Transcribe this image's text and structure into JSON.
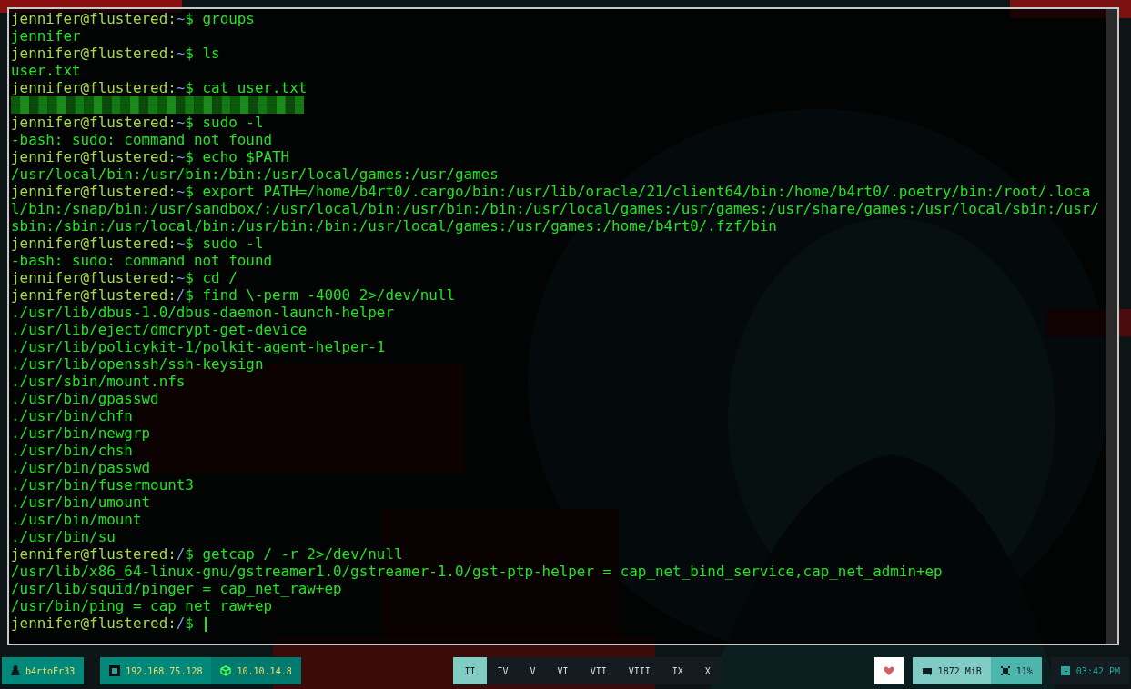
{
  "terminal": {
    "lines": [
      {
        "kind": "prompt",
        "user": "jennifer@flustered:",
        "path": "~",
        "sign": "$",
        "command": "groups"
      },
      {
        "kind": "output",
        "text": "jennifer"
      },
      {
        "kind": "prompt",
        "user": "jennifer@flustered:",
        "path": "~",
        "sign": "$",
        "command": "ls"
      },
      {
        "kind": "output",
        "text": "user.txt"
      },
      {
        "kind": "prompt",
        "user": "jennifer@flustered:",
        "path": "~",
        "sign": "$",
        "command": "cat user.txt"
      },
      {
        "kind": "redacted"
      },
      {
        "kind": "prompt",
        "user": "jennifer@flustered:",
        "path": "~",
        "sign": "$",
        "command": "sudo -l"
      },
      {
        "kind": "output",
        "text": "-bash: sudo: command not found"
      },
      {
        "kind": "prompt",
        "user": "jennifer@flustered:",
        "path": "~",
        "sign": "$",
        "command": "echo $PATH"
      },
      {
        "kind": "output",
        "text": "/usr/local/bin:/usr/bin:/bin:/usr/local/games:/usr/games"
      },
      {
        "kind": "prompt",
        "user": "jennifer@flustered:",
        "path": "~",
        "sign": "$",
        "command": "export PATH=/home/b4rt0/.cargo/bin:/usr/lib/oracle/21/client64/bin:/home/b4rt0/.poetry/bin:/root/.local/bin:/snap/bin:/usr/sandbox/:/usr/local/bin:/usr/bin:/bin:/usr/local/games:/usr/games:/usr/share/games:/usr/local/sbin:/usr/sbin:/sbin:/usr/local/bin:/usr/bin:/bin:/usr/local/games:/usr/games:/home/b4rt0/.fzf/bin"
      },
      {
        "kind": "prompt",
        "user": "jennifer@flustered:",
        "path": "~",
        "sign": "$",
        "command": "sudo -l"
      },
      {
        "kind": "output",
        "text": "-bash: sudo: command not found"
      },
      {
        "kind": "prompt",
        "user": "jennifer@flustered:",
        "path": "~",
        "sign": "$",
        "command": "cd /"
      },
      {
        "kind": "prompt",
        "user": "jennifer@flustered:",
        "path": "/",
        "sign": "$",
        "command": "find \\-perm -4000 2>/dev/null"
      },
      {
        "kind": "output",
        "text": "./usr/lib/dbus-1.0/dbus-daemon-launch-helper"
      },
      {
        "kind": "output",
        "text": "./usr/lib/eject/dmcrypt-get-device"
      },
      {
        "kind": "output",
        "text": "./usr/lib/policykit-1/polkit-agent-helper-1"
      },
      {
        "kind": "output",
        "text": "./usr/lib/openssh/ssh-keysign"
      },
      {
        "kind": "output",
        "text": "./usr/sbin/mount.nfs"
      },
      {
        "kind": "output",
        "text": "./usr/bin/gpasswd"
      },
      {
        "kind": "output",
        "text": "./usr/bin/chfn"
      },
      {
        "kind": "output",
        "text": "./usr/bin/newgrp"
      },
      {
        "kind": "output",
        "text": "./usr/bin/chsh"
      },
      {
        "kind": "output",
        "text": "./usr/bin/passwd"
      },
      {
        "kind": "output",
        "text": "./usr/bin/fusermount3"
      },
      {
        "kind": "output",
        "text": "./usr/bin/umount"
      },
      {
        "kind": "output",
        "text": "./usr/bin/mount"
      },
      {
        "kind": "output",
        "text": "./usr/bin/su"
      },
      {
        "kind": "prompt",
        "user": "jennifer@flustered:",
        "path": "/",
        "sign": "$",
        "command": "getcap / -r 2>/dev/null"
      },
      {
        "kind": "output",
        "text": "/usr/lib/x86_64-linux-gnu/gstreamer1.0/gstreamer-1.0/gst-ptp-helper = cap_net_bind_service,cap_net_admin+ep"
      },
      {
        "kind": "output",
        "text": "/usr/lib/squid/pinger = cap_net_raw+ep"
      },
      {
        "kind": "output",
        "text": "/usr/bin/ping = cap_net_raw+ep"
      },
      {
        "kind": "prompt",
        "user": "jennifer@flustered:",
        "path": "/",
        "sign": "$",
        "cursor": true
      }
    ]
  },
  "taskbar": {
    "user": "b4rtoFr33",
    "addresses": [
      {
        "kind": "ethernet",
        "text": "192.168.75.128"
      },
      {
        "kind": "vpn",
        "text": "10.10.14.8"
      }
    ],
    "workspaces": [
      {
        "label": "II",
        "selected": true
      },
      {
        "label": "IV",
        "selected": false
      },
      {
        "label": "V",
        "selected": false
      },
      {
        "label": "VI",
        "selected": false
      },
      {
        "label": "VII",
        "selected": false
      },
      {
        "label": "VIII",
        "selected": false
      },
      {
        "label": "IX",
        "selected": false
      },
      {
        "label": "X",
        "selected": false
      }
    ],
    "memory": "1872 MiB",
    "cpu": "11%",
    "clock": "03:42 PM"
  }
}
